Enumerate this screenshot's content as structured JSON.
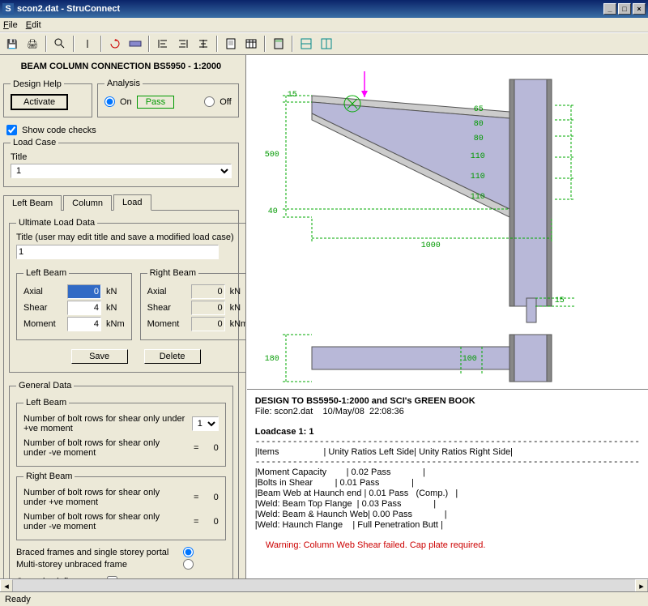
{
  "title": "scon2.dat - StruConnect",
  "menus": [
    "File",
    "Edit"
  ],
  "heading": "BEAM COLUMN CONNECTION BS5950 - 1:2000",
  "designHelp": {
    "legend": "Design Help",
    "activate": "Activate"
  },
  "analysis": {
    "legend": "Analysis",
    "on": "On",
    "off": "Off",
    "onSel": true,
    "pass": "Pass"
  },
  "showCodeChecks": {
    "label": "Show code checks",
    "checked": true
  },
  "loadCase": {
    "legend": "Load Case",
    "titleLabel": "Title",
    "value": "1"
  },
  "tabs": {
    "leftBeam": "Left Beam",
    "column": "Column",
    "load": "Load"
  },
  "uld": {
    "legend": "Ultimate Load Data",
    "titleNote": "Title (user may edit title and save a modified load case)",
    "titleVal": "1",
    "leftBeam": {
      "legend": "Left Beam",
      "axial": "Axial",
      "shear": "Shear",
      "moment": "Moment",
      "axialV": "0",
      "shearV": "4",
      "momentV": "4",
      "unitForce": "kN",
      "unitMoment": "kNm"
    },
    "rightBeam": {
      "legend": "Right Beam",
      "axialV": "0",
      "shearV": "0",
      "momentV": "0"
    },
    "save": "Save",
    "delete": "Delete"
  },
  "general": {
    "legend": "General Data",
    "leftBeamLegend": "Left Beam",
    "rightBeamLegend": "Right Beam",
    "posMoment": "Number of bolt rows for shear only under +ve moment",
    "negMoment": "Number of bolt rows for shear only under -ve moment",
    "leftPosVal": "1",
    "leftNegVal": "0",
    "rightPosVal": "0",
    "rightNegVal": "0",
    "braced": "Braced frames and single storey portal",
    "multi": "Multi-storey unbraced frame",
    "bracedSel": true,
    "corrosive": "Corrosive influence"
  },
  "dims": {
    "w": "1000",
    "hmain": "500",
    "htop": "15",
    "hbot": "40",
    "hbot2": "15",
    "plan_h": "180",
    "plan_w": "100",
    "r1": "65",
    "r2": "80",
    "r3": "80",
    "r4": "110",
    "r5": "110",
    "r6": "110"
  },
  "results": {
    "h1": "DESIGN TO BS5950-1:2000 and SCI's GREEN BOOK",
    "h2": "File: scon2.dat    10/May/08  22:08:36",
    "h3": "Loadcase 1: 1",
    "hdr": "|Items                  | Unity Ratios Left Side| Unity Ratios Right Side|",
    "rows": [
      "|Moment Capacity        | 0.02 Pass             |",
      "|Bolts in Shear         | 0.01 Pass             |",
      "|Beam Web at Haunch end | 0.01 Pass   (Comp.)   |",
      "|Weld: Beam Top Flange  | 0.03 Pass             |",
      "|Weld: Beam & Haunch Web| 0.00 Pass             |",
      "|Weld: Haunch Flange    | Full Penetration Butt |"
    ],
    "warn": "Warning: Column Web Shear failed. Cap plate required."
  },
  "status": "Ready",
  "eq": "="
}
